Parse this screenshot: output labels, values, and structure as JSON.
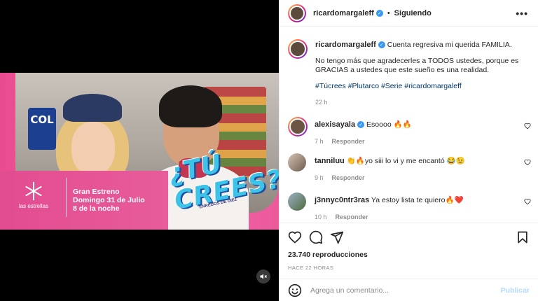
{
  "post": {
    "username": "ricardomargaleff",
    "follow_state": "Siguiendo",
    "more_glyph": "•••",
    "caption_line1": "Cuenta regresiva mi querida FAMILIA.",
    "caption_line2": "No tengo más que agradecerles a TODOS ustedes, porque es GRACIAS a ustedes que este sueño es una realidad.",
    "hashtags": "#Túcrees #Plutarco #Serie #ricardomargaleff",
    "caption_time": "22 h"
  },
  "video": {
    "network_name": "las estrellas",
    "promo_line1": "Gran Estreno",
    "promo_line2": "Domingo 31 de Julio",
    "promo_line3": "8 de la noche",
    "show_title_1": "¿TÚ",
    "show_title_2": "CREES?",
    "show_subtitle": "ENREDOS DE DIEZ",
    "store_sign": "COL",
    "mute_icon": "muted-speaker-icon"
  },
  "comments": [
    {
      "user": "alexisayala",
      "verified": true,
      "text": "Esoooo",
      "emoji": "🔥🔥",
      "time": "7 h",
      "reply": "Responder"
    },
    {
      "user": "tanniluu",
      "verified": false,
      "text": "yo siii lo vi y me encantó",
      "emoji_before": "👏🔥",
      "emoji_after": "😂😉",
      "time": "9 h",
      "reply": "Responder"
    },
    {
      "user": "j3nnyc0ntr3ras",
      "verified": false,
      "text": "Ya estoy lista te quiero",
      "emoji": "🔥❤️",
      "time": "10 h",
      "reply": "Responder"
    }
  ],
  "stats": {
    "views": "23.740 reproducciones",
    "posted": "HACE 22 HORAS"
  },
  "composer": {
    "placeholder": "Agrega un comentario...",
    "publish": "Publicar"
  },
  "colors": {
    "link": "#00376b",
    "publish_disabled": "#b3dbff",
    "verified": "#3897f0",
    "video_pink": "#e94b8f"
  }
}
